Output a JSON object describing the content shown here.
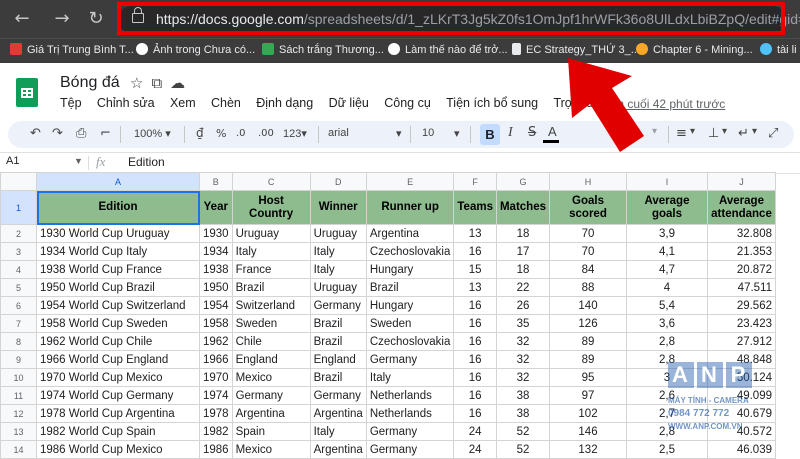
{
  "browser": {
    "url_host": "https://docs.google.com",
    "url_path": "/spreadsheets/d/1_zLKrT3Jg5kZ0fs1OmJpf1hrWFk36o8UlLdxLbiBZpQ/edit#gid=0",
    "bookmarks": [
      {
        "label": "Giá Trị Trung Bình T...",
        "icon_color": "#e53935"
      },
      {
        "label": "Ảnh trong Chưa có...",
        "icon_color": "#ffffff"
      },
      {
        "label": "Sách trắng Thương...",
        "icon_color": "#34a853"
      },
      {
        "label": "Làm thế nào để trở...",
        "icon_color": "#ffffff"
      },
      {
        "label": "EC Strategy_THỨ 3_...",
        "icon_color": "#e8eaed"
      },
      {
        "label": "Chapter 6 - Mining...",
        "icon_color": "#f9a825"
      },
      {
        "label": "tài li",
        "icon_color": "#4fc3f7"
      }
    ]
  },
  "doc": {
    "title": "Bóng đá",
    "last_edit": "lần cuối 42 phút trước",
    "menu": [
      "Tệp",
      "Chỉnh sửa",
      "Xem",
      "Chèn",
      "Định dạng",
      "Dữ liệu",
      "Công cụ",
      "Tiện ích bổ sung",
      "Trợ giúp"
    ]
  },
  "toolbar": {
    "zoom": "100%",
    "currency": "₫",
    "percent": "%",
    "dec_less": ".0",
    "dec_more": ".00",
    "format_more": "123",
    "font": "arial",
    "font_size": "10",
    "bold": "B",
    "italic": "I",
    "strike": "S",
    "text_color": "A"
  },
  "formula_bar": {
    "cell_ref": "A1",
    "fx": "fx",
    "value": "Edition"
  },
  "sheet": {
    "columns": [
      "A",
      "B",
      "C",
      "D",
      "E",
      "F",
      "G",
      "H",
      "I",
      "J"
    ],
    "headers": [
      "Edition",
      "Year",
      "Host Country",
      "Winner",
      "Runner up",
      "Teams",
      "Matches",
      "Goals scored",
      "Average goals",
      "Average attendance"
    ],
    "rows": [
      {
        "n": "2",
        "cells": [
          "1930 World Cup Uruguay",
          "1930",
          "Uruguay",
          "Uruguay",
          "Argentina",
          "13",
          "18",
          "70",
          "3,9",
          "32.808"
        ]
      },
      {
        "n": "3",
        "cells": [
          "1934 World Cup Italy",
          "1934",
          "Italy",
          "Italy",
          "Czechoslovakia",
          "16",
          "17",
          "70",
          "4,1",
          "21.353"
        ]
      },
      {
        "n": "4",
        "cells": [
          "1938 World Cup France",
          "1938",
          "France",
          "Italy",
          "Hungary",
          "15",
          "18",
          "84",
          "4,7",
          "20.872"
        ]
      },
      {
        "n": "5",
        "cells": [
          "1950 World Cup Brazil",
          "1950",
          "Brazil",
          "Uruguay",
          "Brazil",
          "13",
          "22",
          "88",
          "4",
          "47.511"
        ]
      },
      {
        "n": "6",
        "cells": [
          "1954 World Cup Switzerland",
          "1954",
          "Switzerland",
          "Germany",
          "Hungary",
          "16",
          "26",
          "140",
          "5,4",
          "29.562"
        ]
      },
      {
        "n": "7",
        "cells": [
          "1958 World Cup Sweden",
          "1958",
          "Sweden",
          "Brazil",
          "Sweden",
          "16",
          "35",
          "126",
          "3,6",
          "23.423"
        ]
      },
      {
        "n": "8",
        "cells": [
          "1962 World Cup Chile",
          "1962",
          "Chile",
          "Brazil",
          "Czechoslovakia",
          "16",
          "32",
          "89",
          "2,8",
          "27.912"
        ]
      },
      {
        "n": "9",
        "cells": [
          "1966 World Cup England",
          "1966",
          "England",
          "England",
          "Germany",
          "16",
          "32",
          "89",
          "2,8",
          "48.848"
        ]
      },
      {
        "n": "10",
        "cells": [
          "1970 World Cup Mexico",
          "1970",
          "Mexico",
          "Brazil",
          "Italy",
          "16",
          "32",
          "95",
          "3",
          "50.124"
        ]
      },
      {
        "n": "11",
        "cells": [
          "1974 World Cup Germany",
          "1974",
          "Germany",
          "Germany",
          "Netherlands",
          "16",
          "38",
          "97",
          "2,6",
          "49.099"
        ]
      },
      {
        "n": "12",
        "cells": [
          "1978 World Cup Argentina",
          "1978",
          "Argentina",
          "Argentina",
          "Netherlands",
          "16",
          "38",
          "102",
          "2,7",
          "40.679"
        ]
      },
      {
        "n": "13",
        "cells": [
          "1982 World Cup Spain",
          "1982",
          "Spain",
          "Italy",
          "Germany",
          "24",
          "52",
          "146",
          "2,8",
          "40.572"
        ]
      },
      {
        "n": "14",
        "cells": [
          "1986 World Cup Mexico",
          "1986",
          "Mexico",
          "Argentina",
          "Germany",
          "24",
          "52",
          "132",
          "2,5",
          "46.039"
        ]
      }
    ]
  },
  "watermark": {
    "logo": "ANP",
    "line1": "MÁY TÍNH - CAMERA",
    "line2": "0984 772 772",
    "line3": "WWW.ANP.COM.VN"
  },
  "colors": {
    "header_fill": "#8fbc8f",
    "annotation_red": "#e00000",
    "selection_blue": "#1a73e8"
  }
}
